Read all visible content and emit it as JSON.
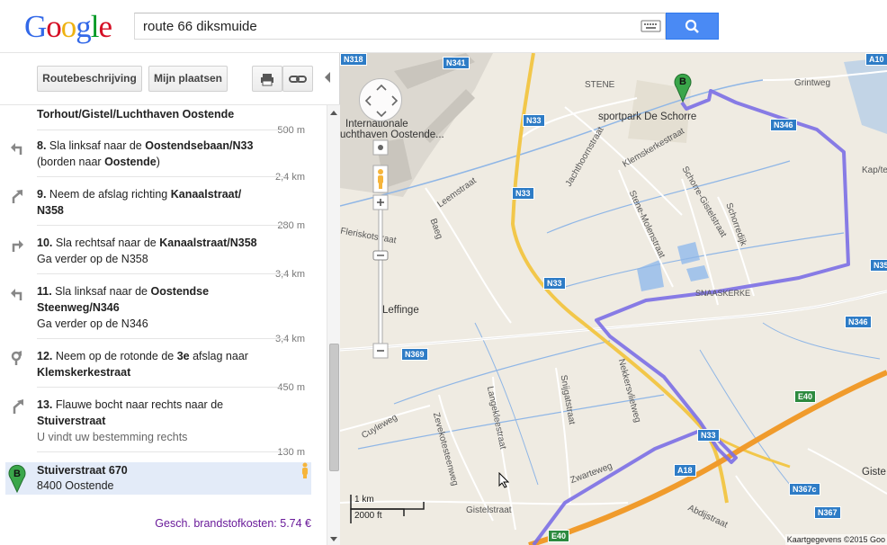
{
  "logo": {
    "letters": [
      "G",
      "o",
      "o",
      "g",
      "l",
      "e"
    ]
  },
  "search": {
    "value": "route 66 diksmuide"
  },
  "toolbar": {
    "route_label": "Routebeschrijving",
    "places_label": "Mijn plaatsen"
  },
  "steps": [
    {
      "lines": [
        "Torhout/Gistel/Luchthaven Oostende"
      ],
      "distance": "500 m"
    },
    {
      "number": "8.",
      "html_lines": [
        "Sla linksaf naar de",
        "Oostendsebaan/N33",
        "(borden naar",
        "Oostende",
        ")"
      ],
      "line1": "Sla linksaf naar de ",
      "bold1": "Oostendsebaan/N33",
      "line2": "(borden naar ",
      "bold2": "Oostende",
      "line2b": ")",
      "distance": "2,4 km"
    },
    {
      "number": "9.",
      "line1": "Neem de afslag richting ",
      "bold1": "Kanaalstraat/",
      "bold2": "N358",
      "distance": "280 m"
    },
    {
      "number": "10.",
      "line1": "Sla rechtsaf naar de ",
      "bold1": "Kanaalstraat/N358",
      "line2": "Ga verder op de N358",
      "distance": "3,4 km"
    },
    {
      "number": "11.",
      "line1": "Sla linksaf naar de ",
      "bold1": "Oostendse",
      "bold2": "Steenweg/N346",
      "line3": "Ga verder op de N346",
      "distance": "3,4 km"
    },
    {
      "number": "12.",
      "line1": "Neem op de rotonde de ",
      "bold1": "3e",
      "line1b": " afslag naar",
      "bold2": "Klemskerkestraat",
      "distance": "450 m"
    },
    {
      "number": "13.",
      "line1": "Flauwe bocht naar rechts naar de",
      "bold1": "Stuiverstraat",
      "note": "U vindt uw bestemming rechts",
      "distance": "130 m"
    }
  ],
  "destination": {
    "marker": "B",
    "name": "Stuiverstraat 670",
    "address": "8400 Oostende"
  },
  "fuel_cost": "Gesch. brandstofkosten: 5.74 €",
  "map": {
    "labels": {
      "stene": "STENE",
      "sportpark": "sportpark De Schorre",
      "grintweg": "Grintweg",
      "airport1": "Internationale",
      "airport2": "uchthaven Oostende...",
      "jachthoorn": "Jachthoornstraat",
      "klemskerke": "Klemskerkestraat",
      "schorre": "Schorre-Gistelstraat",
      "schorredijk": "Schorredijk",
      "stene_molen": "Stene-Molenstraat",
      "leemstraat": "Leemstraat",
      "flenskots": "Fleriskotstraat",
      "leffinge": "Leffinge",
      "snaaskerke": "SNAASKERKE",
      "nekkers": "Nekkersvlietweg",
      "snijgat": "Snijgatstraat",
      "langeklee": "Langekleestraat",
      "zevekote": "Zevekotesteenweg",
      "cuyleweg": "Cuyleweg",
      "zwarteweg": "Zwarteweg",
      "gistelstraat": "Gistelstraat",
      "abdijstraat": "Abdijstraat",
      "gistel": "Giste",
      "kap": "Kap/tel",
      "baeg": "Baeg"
    },
    "shields": {
      "n318": "N318",
      "n341": "N341",
      "n33a": "N33",
      "n33b": "N33",
      "n33c": "N33",
      "n33d": "N33",
      "n346a": "N346",
      "n346b": "N346",
      "n369": "N369",
      "n367c": "N367c",
      "n367": "N367",
      "e40a": "E40",
      "e40b": "E40",
      "a18": "A18",
      "n35": "N35",
      "a10": "A10"
    },
    "marker": "B",
    "scale_km": "1 km",
    "scale_ft": "2000 ft",
    "attribution": "Kaartgegevens ©2015 Goo"
  },
  "colors": {
    "route": "#7b6fe6",
    "accent": "#4a8af4",
    "fuel": "#6a1b9a"
  }
}
